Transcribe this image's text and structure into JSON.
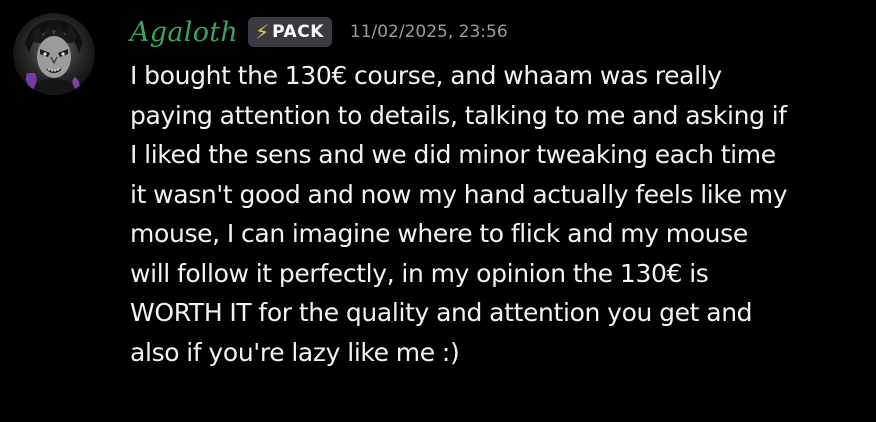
{
  "message": {
    "username": "Agaloth",
    "username_color": "#3aa55d",
    "tag": {
      "icon": "lightning-bolt-icon",
      "icon_glyph": "⚡",
      "label": "PACK"
    },
    "timestamp": "11/02/2025, 23:56",
    "avatar": "avatar-dark-masked-character",
    "content_lines": [
      "I bought the 130€ course, and whaam was really",
      "paying attention to details, talking to me and asking if",
      "I liked the sens and we did minor tweaking each time",
      "it wasn't good and now my hand actually feels like my",
      "mouse, I can imagine where to flick and my mouse",
      "will follow it perfectly, in my opinion the 130€ is",
      "WORTH IT for the quality and attention you get and",
      "also if you're lazy like me :)"
    ]
  }
}
